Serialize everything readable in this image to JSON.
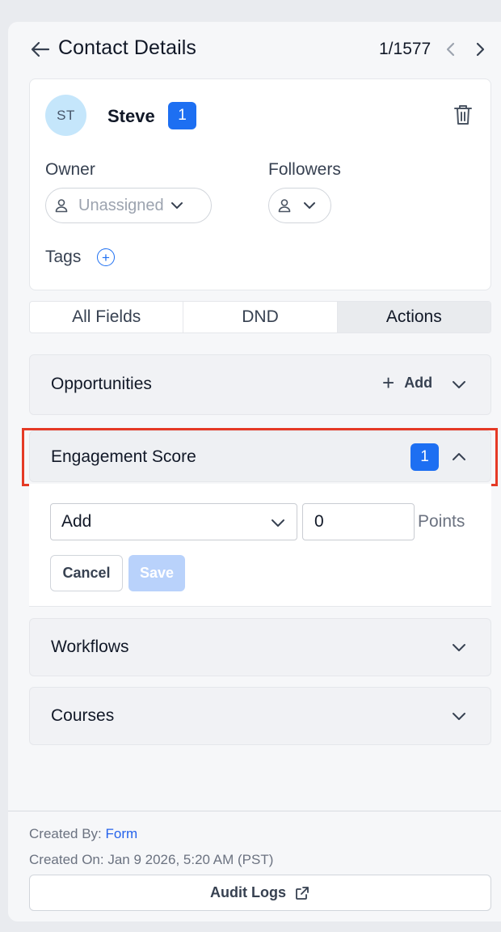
{
  "header": {
    "title": "Contact Details",
    "counter": "1/1577"
  },
  "contact": {
    "initials": "ST",
    "name": "Steve",
    "badge": "1",
    "owner_label": "Owner",
    "owner_value": "Unassigned",
    "followers_label": "Followers",
    "tags_label": "Tags"
  },
  "tabs": [
    {
      "label": "All Fields",
      "active": false
    },
    {
      "label": "DND",
      "active": false
    },
    {
      "label": "Actions",
      "active": true
    }
  ],
  "sections": {
    "opportunities": {
      "title": "Opportunities",
      "add_label": "Add"
    },
    "engagement": {
      "title": "Engagement Score",
      "badge": "1",
      "select_value": "Add",
      "points_value": "0",
      "points_label": "Points",
      "cancel_label": "Cancel",
      "save_label": "Save"
    },
    "workflows": {
      "title": "Workflows"
    },
    "courses": {
      "title": "Courses"
    }
  },
  "footer": {
    "created_by_label": "Created By: ",
    "created_by_value": "Form",
    "created_on": "Created On: Jan 9 2026, 5:20 AM (PST)",
    "audit_label": "Audit Logs"
  },
  "colors": {
    "accent": "#1d6ff2",
    "highlight": "#e53a26",
    "avatar_bg": "#c5e6fb"
  },
  "icons": [
    "arrow-left-icon",
    "chevron-left-icon",
    "chevron-right-icon",
    "trash-icon",
    "user-icon",
    "chevron-down-icon",
    "plus-icon",
    "chevron-up-icon",
    "external-link-icon"
  ]
}
